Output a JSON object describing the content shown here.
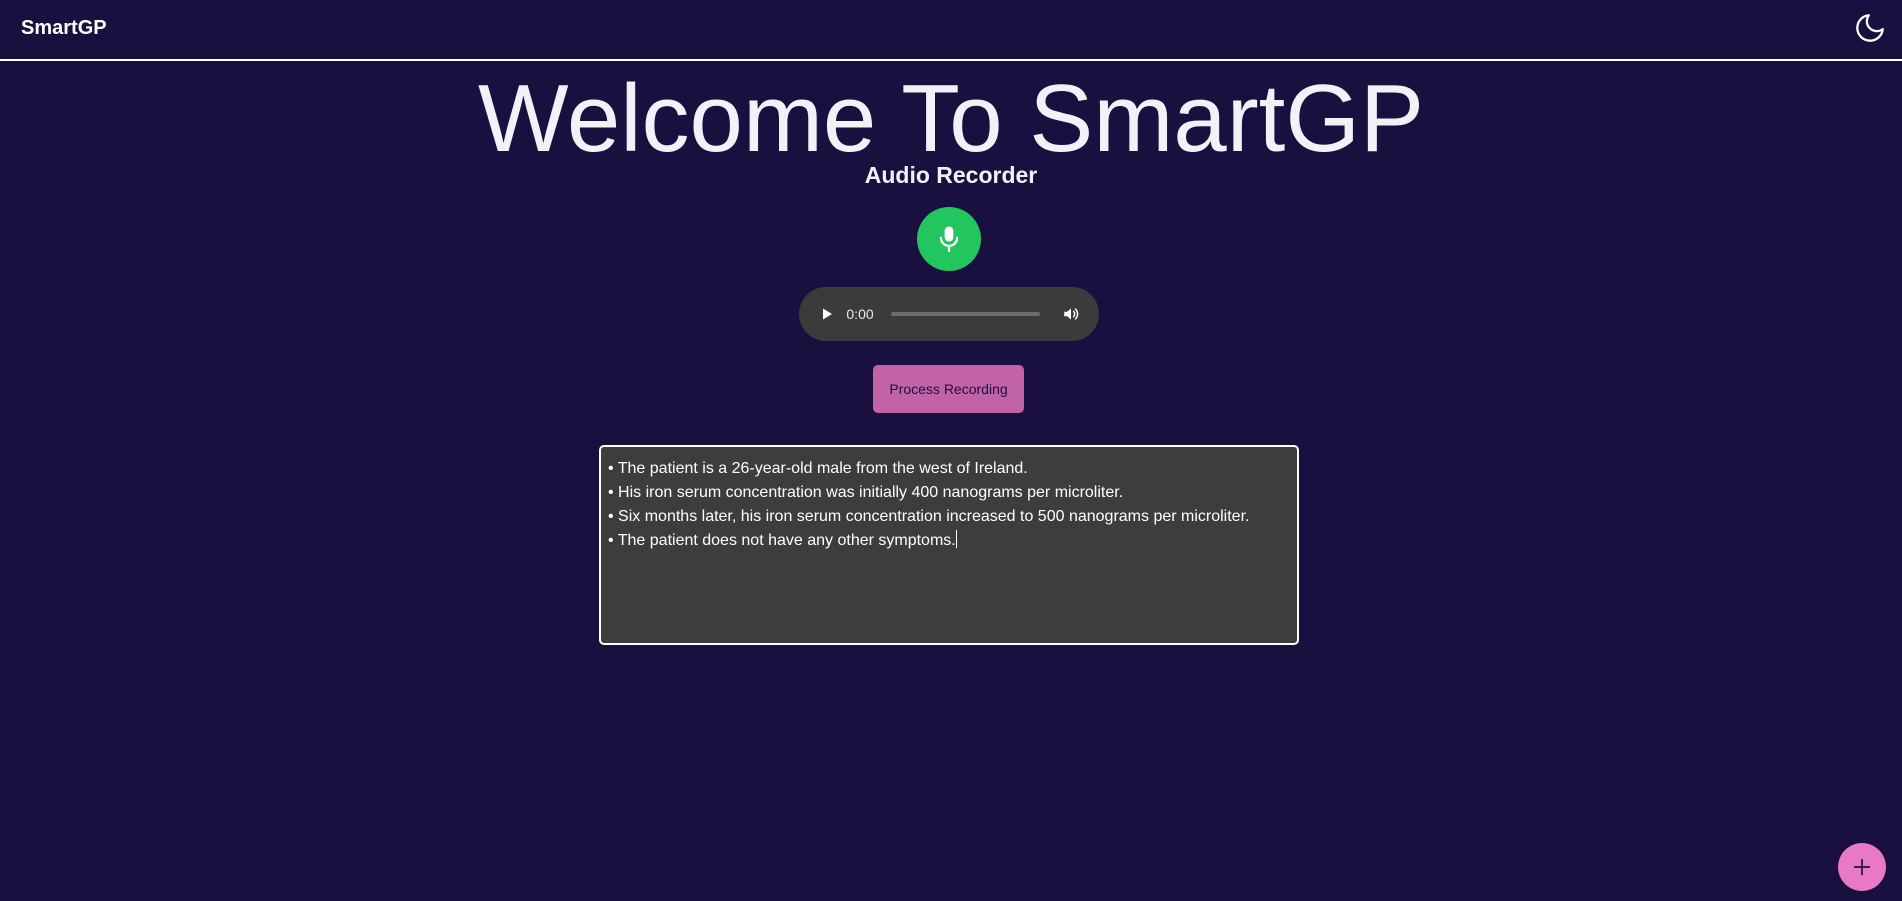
{
  "app": {
    "brand": "SmartGP",
    "theme_icon": "moon-icon"
  },
  "main": {
    "welcome_title": "Welcome To SmartGP",
    "recorder_title": "Audio Recorder",
    "mic_icon": "microphone-icon",
    "mic_color": "#22c55e"
  },
  "audio_player": {
    "current_time": "0:00",
    "progress": 0,
    "play_icon": "play-icon",
    "volume_icon": "volume-icon"
  },
  "process_button": {
    "label": "Process Recording",
    "color": "#c263a8"
  },
  "notes": {
    "lines": [
      "• The patient is a 26-year-old male from the west of Ireland.",
      "• His iron serum concentration was initially 400 nanograms per microliter.",
      "• Six months later, his iron serum concentration increased to 500 nanograms per microliter.",
      "• The patient does not have any other symptoms."
    ]
  },
  "fab": {
    "icon": "plus-icon",
    "color": "#e879c6"
  },
  "colors": {
    "background": "#1a1040",
    "text": "#ffffff"
  }
}
